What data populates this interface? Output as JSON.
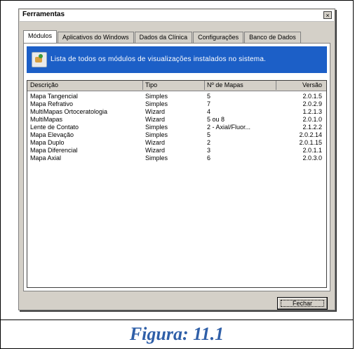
{
  "window": {
    "title": "Ferramentas",
    "close_glyph": "×"
  },
  "tabs": [
    {
      "label": "Módulos",
      "active": true
    },
    {
      "label": "Aplicativos do Windows"
    },
    {
      "label": "Dados da Clínica"
    },
    {
      "label": "Configurações"
    },
    {
      "label": "Banco de Dados"
    }
  ],
  "banner": {
    "text": "Lista de todos os módulos de visualizações instalados no sistema.",
    "icon": "modules-icon",
    "color": "#1c5fc7"
  },
  "table": {
    "headers": [
      "Descrição",
      "Tipo",
      "Nº de Mapas",
      "Versão"
    ],
    "rows": [
      [
        "Mapa Tangencial",
        "Simples",
        "5",
        "2.0.1.5"
      ],
      [
        "Mapa Refrativo",
        "Simples",
        "7",
        "2.0.2.9"
      ],
      [
        "MultiMapas Ortoceratologia",
        "Wizard",
        "4",
        "1.2.1.3"
      ],
      [
        "MultiMapas",
        "Wizard",
        "5 ou 8",
        "2.0.1.0"
      ],
      [
        "Lente de Contato",
        "Simples",
        "2 - Axial/Fluor...",
        "2.1.2.2"
      ],
      [
        "Mapa Elevação",
        "Simples",
        "5",
        "2.0.2.14"
      ],
      [
        "Mapa Duplo",
        "Wizard",
        "2",
        "2.0.1.15"
      ],
      [
        "Mapa Diferencial",
        "Wizard",
        "3",
        "2.0.1.1"
      ],
      [
        "Mapa Axial",
        "Simples",
        "6",
        "2.0.3.0"
      ]
    ]
  },
  "buttons": {
    "close_label": "Fechar"
  },
  "caption": "Figura: 11.1"
}
